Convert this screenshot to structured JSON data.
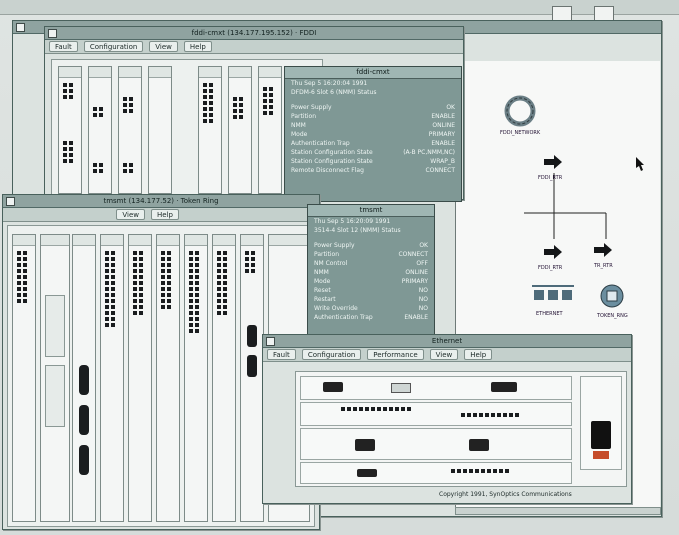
{
  "desktop": {
    "background": "#dfe4e2"
  },
  "windows": {
    "fddi": {
      "title": "fddi-cmxt (134.177.195.152) · FDDI",
      "menus": [
        "Fault",
        "Configuration",
        "View",
        "Help"
      ]
    },
    "token": {
      "title": "tmsmt (134.177.52) · Token Ring",
      "menus": [
        "View",
        "Help"
      ]
    },
    "ethernet": {
      "title": "Ethernet",
      "menus": [
        "Fault",
        "Configuration",
        "Performance",
        "View",
        "Help"
      ],
      "copyright": "Copyright 1991, SynOptics Communications"
    }
  },
  "panels": {
    "fddi_status": {
      "title": "fddi-cmxt",
      "header1": "Thu Sep 5 16:20:04 1991",
      "header2": "DFDM-6 Slot 6 (NMM) Status",
      "rows": [
        [
          "Power Supply",
          "OK"
        ],
        [
          "Partition",
          "ENABLE"
        ],
        [
          "NMM",
          "ONLINE"
        ],
        [
          "Mode",
          "PRIMARY"
        ],
        [
          "Authentication Trap",
          "ENABLE"
        ],
        [
          "Station Configuration State",
          "(A-B PC,NMM,NC)"
        ],
        [
          "Station Configuration State",
          "WRAP_B"
        ],
        [
          "Remote Disconnect Flag",
          "CONNECT"
        ]
      ]
    },
    "token_status": {
      "title": "tmsmt",
      "header1": "Thu Sep 5 16:20:09 1991",
      "header2": "3514-4 Slot 12 (NMM) Status",
      "rows": [
        [
          "Power Supply",
          "OK"
        ],
        [
          "Partition",
          "CONNECT"
        ],
        [
          "NM Control",
          "OFF"
        ],
        [
          "NMM",
          "ONLINE"
        ],
        [
          "Mode",
          "PRIMARY"
        ],
        [
          "Reset",
          "NO"
        ],
        [
          "Restart",
          "NO"
        ],
        [
          "Write Override",
          "NO"
        ],
        [
          "Authentication Trap",
          "ENABLE"
        ]
      ]
    }
  },
  "topology": {
    "labels": {
      "ring": "FDDI_NETWORK",
      "router1": "FDDI_RTR",
      "router2": "FDDI_RTR",
      "router3": "TR_RTR",
      "ethernet": "ETHERNET",
      "token": "TOKEN_RNG"
    },
    "pointer_icon": "arrow-cursor-icon"
  }
}
